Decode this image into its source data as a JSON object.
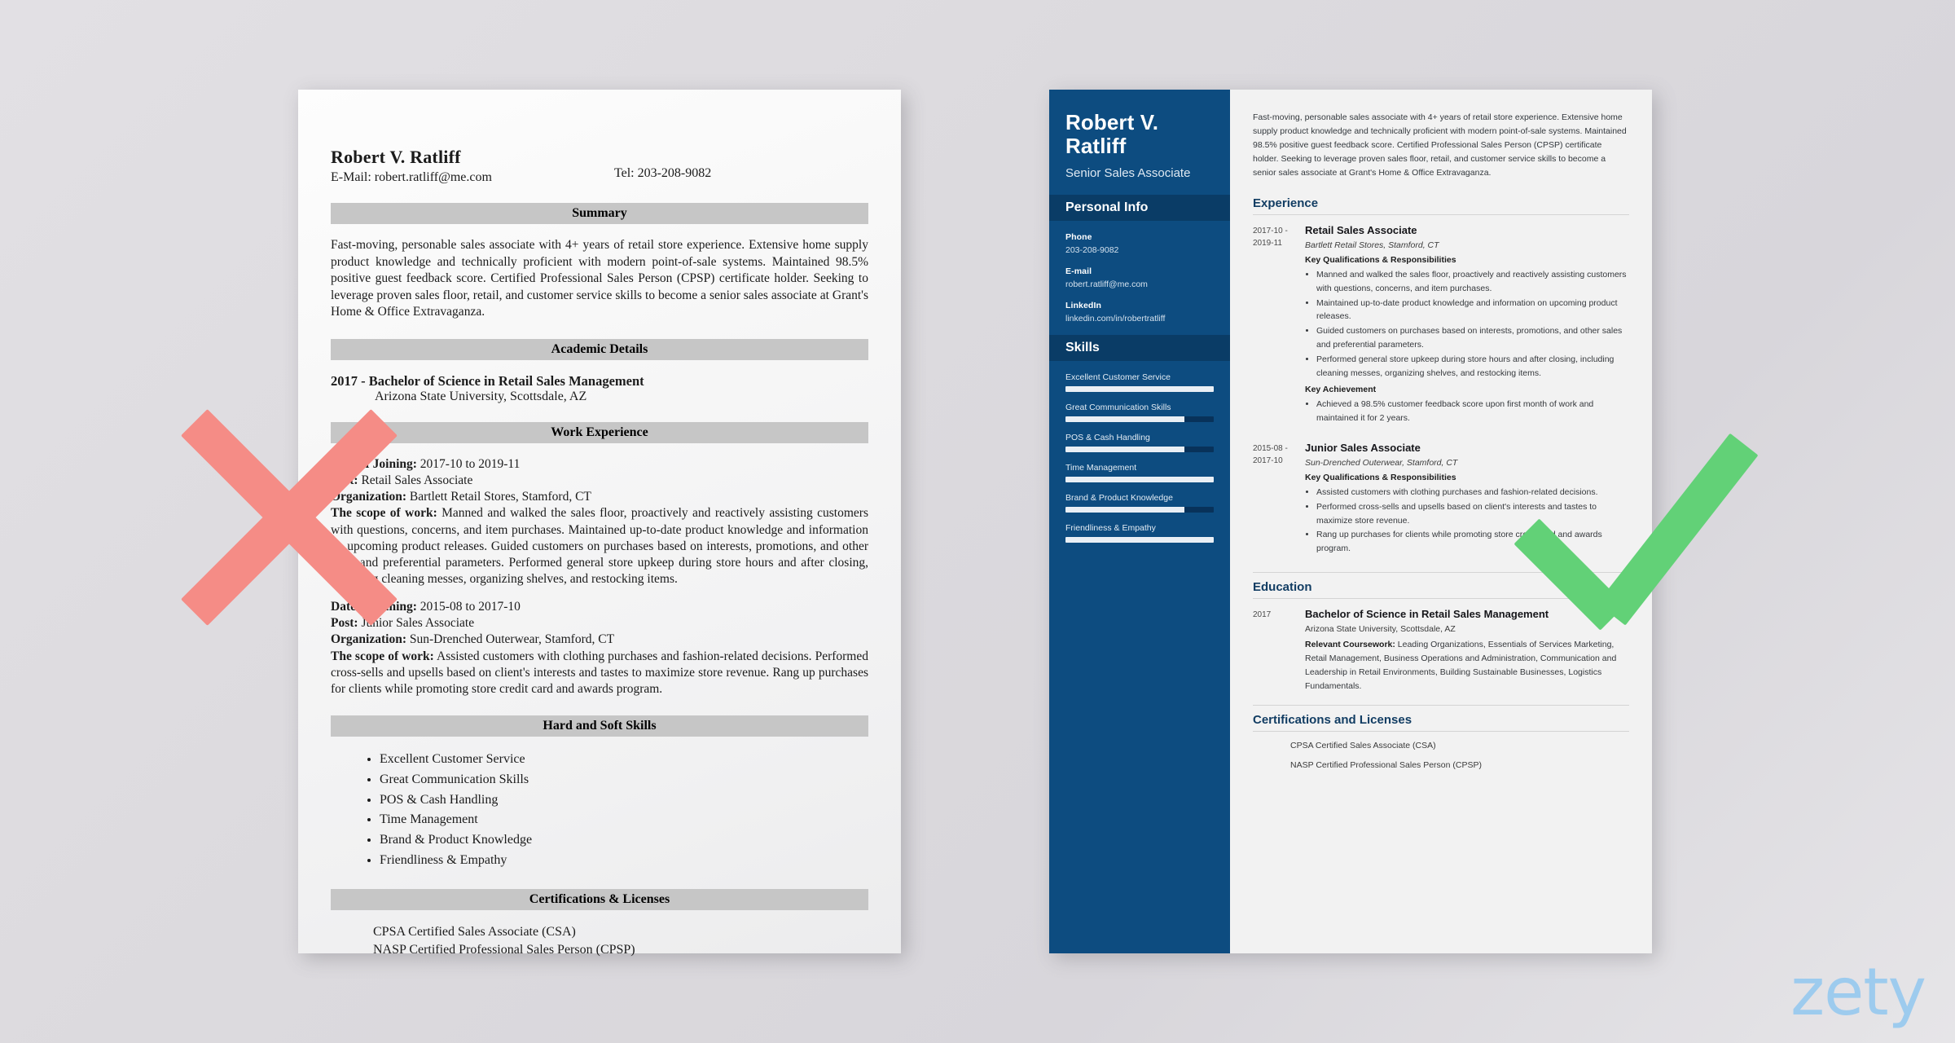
{
  "colors": {
    "background": "#dcdade",
    "sidebar_navy": "#0d4c80",
    "sidebar_bar_navy": "#0a3c66",
    "heading_blue": "#123d63",
    "x_red": "#F58C86",
    "check_green": "#62D177",
    "logo_blue": "#9DCBEE",
    "grey_bar": "#c6c6c6"
  },
  "watermark": {
    "brand": "zety"
  },
  "marks": {
    "bad_mark": "x-mark",
    "good_mark": "check-mark"
  },
  "bad_resume": {
    "name": "Robert V. Ratliff",
    "email": "E-Mail: robert.ratliff@me.com",
    "phone": "Tel: 203-208-9082",
    "sections": {
      "summary_heading": "Summary",
      "summary_text": "Fast-moving, personable sales associate with 4+ years of retail store experience. Extensive home supply product knowledge and technically proficient with modern point-of-sale systems. Maintained 98.5% positive guest feedback score. Certified Professional Sales Person (CPSP) certificate holder. Seeking to leverage proven sales floor, retail, and customer service skills to become a senior sales associate at Grant's Home & Office Extravaganza.",
      "academic_heading": "Academic Details",
      "academic_degree": "2017 - Bachelor of Science in Retail Sales Management",
      "academic_school": "Arizona State University, Scottsdale, AZ",
      "work_heading": "Work Experience",
      "skills_heading": "Hard and Soft Skills",
      "certs_heading": "Certifications & Licenses"
    },
    "jobs": [
      {
        "date_label": "Date of Joining:",
        "date_value": " 2017-10 to 2019-11",
        "post_label": "Post:",
        "post_value": " Retail Sales Associate",
        "org_label": "Organization:",
        "org_value": " Bartlett Retail Stores, Stamford, CT",
        "scope_label": "The scope of work:",
        "scope_value": " Manned and walked the sales floor, proactively and reactively assisting customers with questions, concerns, and item purchases. Maintained up-to-date product knowledge and information on upcoming product releases. Guided customers on purchases based on interests, promotions, and other sales and preferential parameters. Performed general store upkeep during store hours and after closing, including cleaning messes, organizing shelves, and restocking items."
      },
      {
        "date_label": "Date of Joining:",
        "date_value": " 2015-08 to 2017-10",
        "post_label": "Post:",
        "post_value": " Junior Sales Associate",
        "org_label": "Organization:",
        "org_value": " Sun-Drenched Outerwear, Stamford, CT",
        "scope_label": "The scope of work:",
        "scope_value": " Assisted customers with clothing purchases and fashion-related decisions. Performed cross-sells and upsells based on client's interests and tastes to maximize store revenue. Rang up purchases for clients while promoting store credit card and awards program."
      }
    ],
    "skills": [
      "Excellent Customer Service",
      "Great Communication Skills",
      "POS & Cash Handling",
      "Time Management",
      "Brand & Product Knowledge",
      "Friendliness & Empathy"
    ],
    "certifications": [
      "CPSA Certified Sales Associate (CSA)",
      "NASP Certified Professional Sales Person (CPSP)"
    ]
  },
  "good_resume": {
    "sidebar": {
      "name": "Robert V. Ratliff",
      "role": "Senior Sales Associate",
      "personal_info_heading": "Personal Info",
      "contacts": [
        {
          "label": "Phone",
          "value": "203-208-9082"
        },
        {
          "label": "E-mail",
          "value": "robert.ratliff@me.com"
        },
        {
          "label": "LinkedIn",
          "value": "linkedin.com/in/robertratliff"
        }
      ],
      "skills_heading": "Skills",
      "skills": [
        {
          "name": "Excellent Customer Service",
          "level": 100
        },
        {
          "name": "Great Communication Skills",
          "level": 80
        },
        {
          "name": "POS & Cash Handling",
          "level": 80
        },
        {
          "name": "Time Management",
          "level": 100
        },
        {
          "name": "Brand & Product Knowledge",
          "level": 80
        },
        {
          "name": "Friendliness & Empathy",
          "level": 100
        }
      ]
    },
    "main": {
      "summary": "Fast-moving, personable sales associate with 4+ years of retail store experience. Extensive home supply product knowledge and technically proficient with modern point-of-sale systems. Maintained 98.5% positive guest feedback score. Certified Professional Sales Person (CPSP) certificate holder. Seeking to leverage proven sales floor, retail, and customer service skills to become a senior sales associate at Grant's Home & Office Extravaganza.",
      "experience_heading": "Experience",
      "education_heading": "Education",
      "certifications_heading": "Certifications and Licenses",
      "experience": [
        {
          "date_from": "2017-10 -",
          "date_to": "2019-11",
          "title": "Retail Sales Associate",
          "organization": "Bartlett Retail Stores, Stamford, CT",
          "qual_heading": "Key Qualifications & Responsibilities",
          "bullets": [
            "Manned and walked the sales floor, proactively and reactively assisting customers with questions, concerns, and item purchases.",
            "Maintained up-to-date product knowledge and information on upcoming product releases.",
            "Guided customers on purchases based on interests, promotions, and other sales and preferential parameters.",
            "Performed general store upkeep during store hours and after closing, including cleaning messes, organizing shelves, and restocking items."
          ],
          "achievement_heading": "Key Achievement",
          "achievements": [
            "Achieved a 98.5% customer feedback score upon first month of work and maintained it for 2 years."
          ]
        },
        {
          "date_from": "2015-08 -",
          "date_to": "2017-10",
          "title": "Junior Sales Associate",
          "organization": "Sun-Drenched Outerwear, Stamford, CT",
          "qual_heading": "Key Qualifications & Responsibilities",
          "bullets": [
            "Assisted customers with clothing purchases and fashion-related decisions.",
            "Performed cross-sells and upsells based on client's interests and tastes to maximize store revenue.",
            "Rang up purchases for clients while promoting store credit card and awards program."
          ],
          "achievement_heading": "",
          "achievements": []
        }
      ],
      "education": {
        "date": "2017",
        "degree": "Bachelor of Science in Retail Sales Management",
        "school": "Arizona State University, Scottsdale, AZ",
        "coursework_label": "Relevant Coursework:",
        "coursework_text": " Leading Organizations, Essentials of Services Marketing, Retail Management, Business Operations and Administration, Communication and Leadership in Retail Environments, Building Sustainable Businesses, Logistics Fundamentals."
      },
      "certifications": [
        "CPSA Certified Sales Associate (CSA)",
        "NASP Certified Professional Sales Person (CPSP)"
      ]
    }
  }
}
